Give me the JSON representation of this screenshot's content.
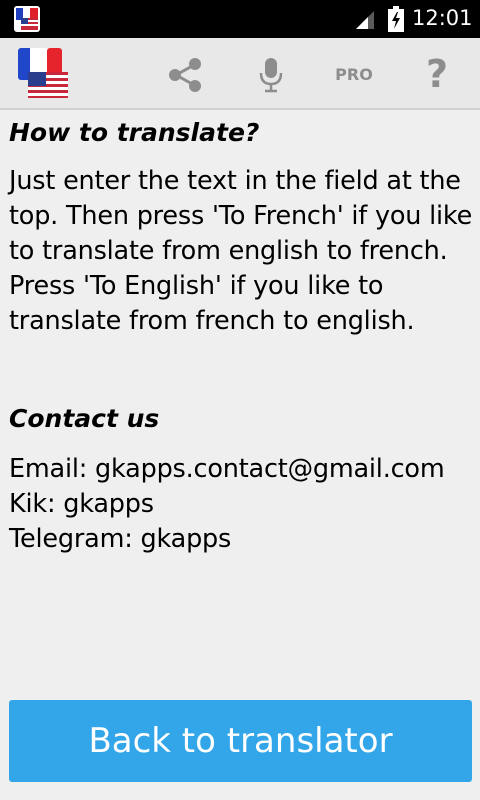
{
  "status_bar": {
    "time": "12:01",
    "icons": [
      "flag-notification-icon",
      "signal-icon",
      "battery-icon"
    ]
  },
  "action_bar": {
    "logo": "flag-logo-icon",
    "share_icon": "share-icon",
    "mic_icon": "microphone-icon",
    "pro_label": "PRO",
    "help_label": "?"
  },
  "help": {
    "how_title": "How to translate?",
    "how_text": "Just enter the text in the field at the top. Then press 'To French' if you like to translate from english to french. Press 'To English' if you like to translate from french to english.",
    "contact_title": "Contact us",
    "email": "Email: gkapps.contact@gmail.com",
    "kik": "Kik: gkapps",
    "telegram": "Telegram: gkapps"
  },
  "back_button_label": "Back to translator",
  "colors": {
    "accent": "#33a6ea",
    "background": "#efeff0",
    "toolbar_icon": "#8d8d8d"
  }
}
